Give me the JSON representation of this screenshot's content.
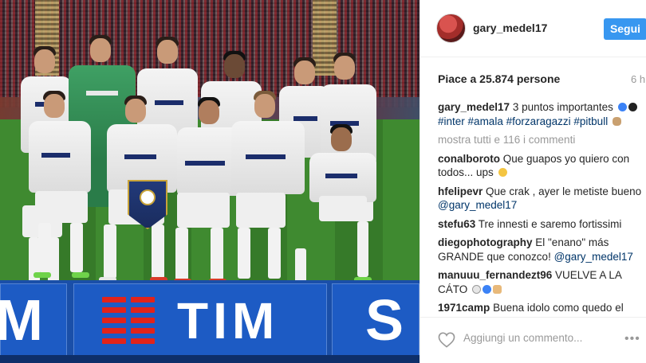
{
  "post": {
    "username": "gary_medel17",
    "follow_label": "Segui",
    "likes_text": "Piace a 25.874 persone",
    "time_ago": "6 h",
    "caption": {
      "username": "gary_medel17",
      "text": "3 puntos importantes",
      "hashtags": [
        "#inter",
        "#amala",
        "#forzaragazzi",
        "#pitbull"
      ]
    },
    "load_more": "mostra tutti e 116 i commenti",
    "comments": [
      {
        "username": "conalboroto",
        "text": "Que guapos yo quiero con todos... ups"
      },
      {
        "username": "hfelipevr",
        "text": "Que crak , ayer le metiste bueno",
        "mention": "@gary_medel17"
      },
      {
        "username": "stefu63",
        "text": "Tre innesti e saremo fortissimi"
      },
      {
        "username": "diegophotography",
        "text": "El \"enano\" más GRANDE que conozco!",
        "mention": "@gary_medel17"
      },
      {
        "username": "manuuu_fernandezt96",
        "text": "VUELVE A LA CÁTO"
      },
      {
        "username": "1971camp",
        "text": "Buena idolo como quedo el tatita qq te estaba criticando"
      }
    ],
    "add_comment_placeholder": "Aggiungi un commento...",
    "more_options": "•••"
  },
  "photo": {
    "sponsor_text": "TIM",
    "ad_left_fragment": "M",
    "ad_right_fragment": "S",
    "shirt_sponsor": "PIRELLI"
  },
  "colors": {
    "follow_button": "#3897f0",
    "hashtag": "#003569",
    "inter_blue": "#1b2d6b",
    "tim_red": "#e2231a"
  },
  "icons": [
    "heart-icon",
    "more-options-icon",
    "blue-circle-emoji",
    "black-circle-emoji",
    "dog-emoji",
    "grinning-emoji",
    "praying-hands-emoji"
  ]
}
